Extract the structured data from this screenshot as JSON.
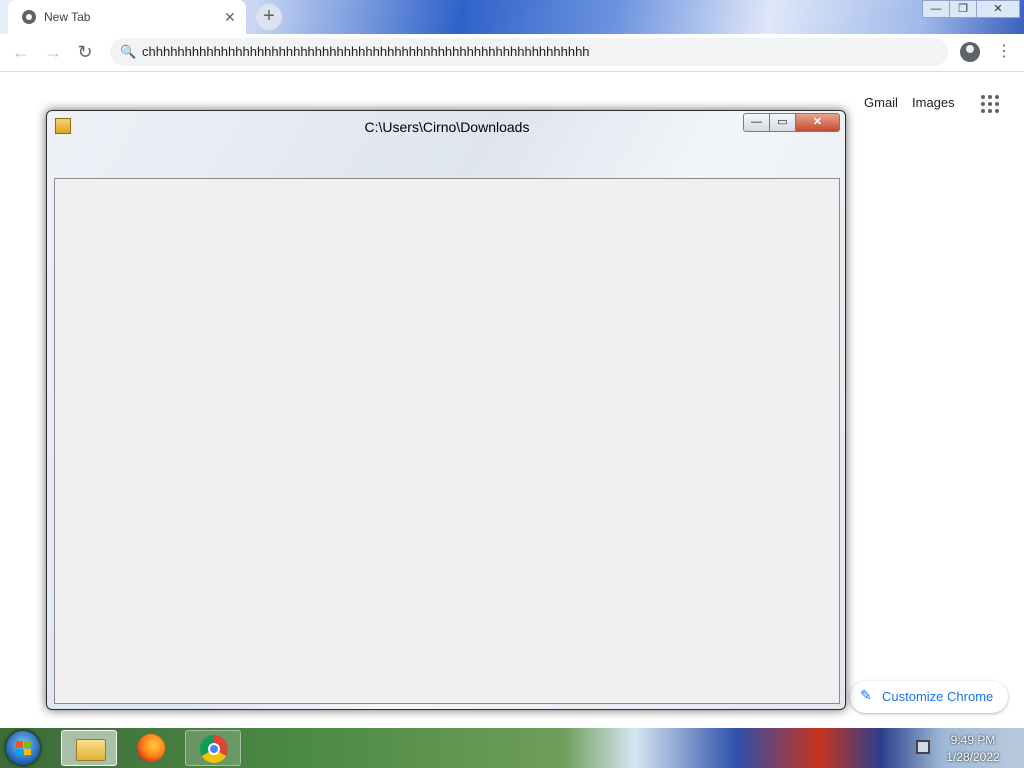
{
  "browser": {
    "tab": {
      "title": "New Tab",
      "close_glyph": "✕",
      "favicon": "chrome-icon"
    },
    "new_tab_glyph": "+",
    "window_controls": {
      "minimize": "—",
      "restore": "❐",
      "close": "✕"
    },
    "toolbar": {
      "back_glyph": "←",
      "forward_glyph": "→",
      "reload_glyph": "↻",
      "search_glyph": "🔍",
      "omnibox_value": "chhhhhhhhhhhhhhhhhhhhhhhhhhhhhhhhhhhhhhhhhhhhhhhhhhhhhhhhhhhhh",
      "menu_glyph": "⋮"
    },
    "ntp": {
      "gmail": "Gmail",
      "images": "Images",
      "customize_label": "Customize Chrome",
      "customize_glyph": "✎"
    }
  },
  "dialog": {
    "title": "C:\\Users\\Cirno\\Downloads",
    "minimize_glyph": "—",
    "restore_glyph": "▭",
    "close_glyph": "✕"
  },
  "taskbar": {
    "items": [
      "windows-explorer",
      "firefox",
      "chrome"
    ],
    "clock": {
      "time": "9:49 PM",
      "date": "1/28/2022"
    }
  }
}
